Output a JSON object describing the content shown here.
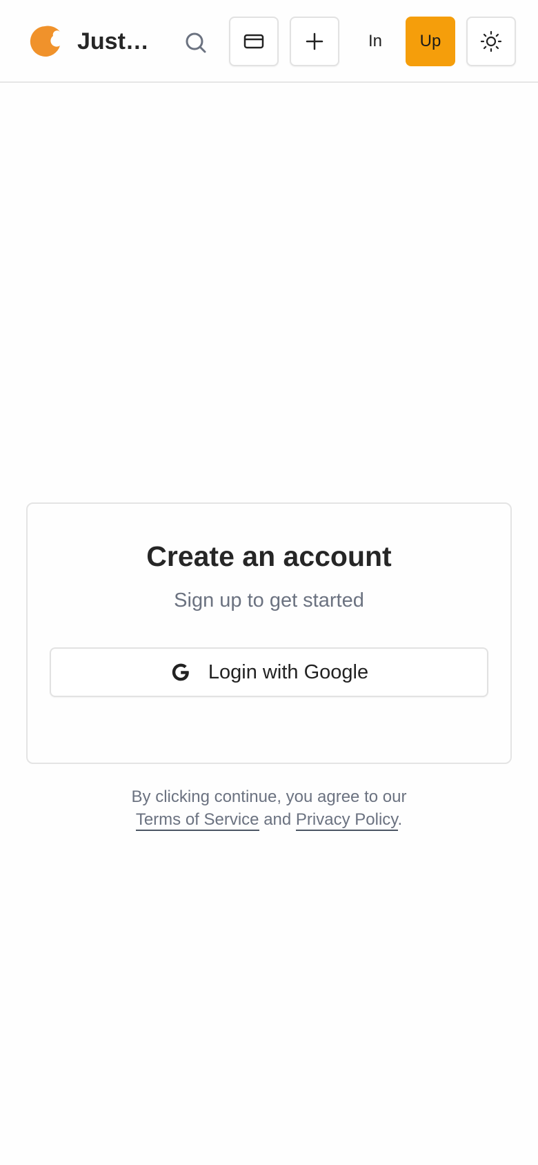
{
  "header": {
    "brand": "Just…",
    "signin_label": "In",
    "signup_label": "Up",
    "icons": [
      "logo",
      "search-icon",
      "credit-card-icon",
      "plus-icon",
      "sun-icon"
    ]
  },
  "colors": {
    "brand_orange": "#f0922b",
    "accent": "#f59e0b",
    "text_muted": "#6b7280"
  },
  "card": {
    "title": "Create an account",
    "subtitle": "Sign up to get started",
    "google_button_label": "Login with Google",
    "google_icon": "google-g-icon"
  },
  "legal": {
    "prefix": "By clicking continue, you agree to our",
    "terms_label": "Terms of Service",
    "joiner": "and",
    "privacy_label": "Privacy Policy",
    "suffix": "."
  }
}
